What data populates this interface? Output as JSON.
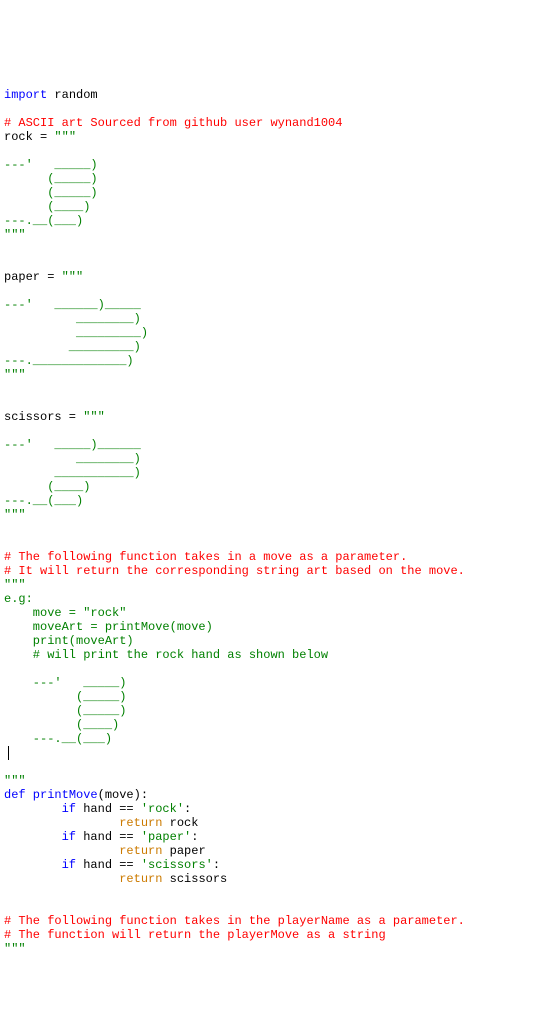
{
  "code": {
    "l1_import": "import",
    "l1_random": " random",
    "blank": "",
    "c1": "# ASCII art Sourced from github user wynand1004",
    "l_rock_assign": "rock = ",
    "triple_quote": "\"\"\"",
    "rock_art": "\n---'   _____)\n      (_____)\n      (_____)\n      (____)\n---.__(___)\n",
    "l_paper_assign": "paper = ",
    "paper_art": "\n---'   ______)_____\n          ________)\n          _________)\n         _________)\n---._____________)\n",
    "l_scissors_assign": "scissors = ",
    "scissors_art": "\n---'   _____)______\n          ________)\n       ___________)\n      (____)\n---.__(___)\n",
    "c2": "# The following function takes in a move as a parameter.",
    "c3": "# It will return the corresponding string art based on the move.",
    "doc1_line1": "e.g:",
    "doc1_line2": "    move = \"rock\"",
    "doc1_line3": "    moveArt = printMove(move)",
    "doc1_line4": "    print(moveArt)",
    "doc1_line5": "    # will print the rock hand as shown below",
    "doc1_rock_art": "\n    ---'   _____)\n          (_____)\n          (_____)\n          (____)\n    ---.__(___)\n",
    "def_kw": "def",
    "def_name": " printMove",
    "def_sig": "(move):",
    "if_kw": "if",
    "return_kw": "return",
    "if1_cond": " hand == ",
    "str_rock": "'rock'",
    "colon": ":",
    "ret_rock": " rock",
    "str_paper": "'paper'",
    "ret_paper": " paper",
    "str_scissors": "'scissors'",
    "ret_scissors": " scissors",
    "c4": "# The following function takes in the playerName as a parameter.",
    "c5": "# The function will return the playerMove as a string",
    "indent8": "        ",
    "indent16": "                "
  }
}
